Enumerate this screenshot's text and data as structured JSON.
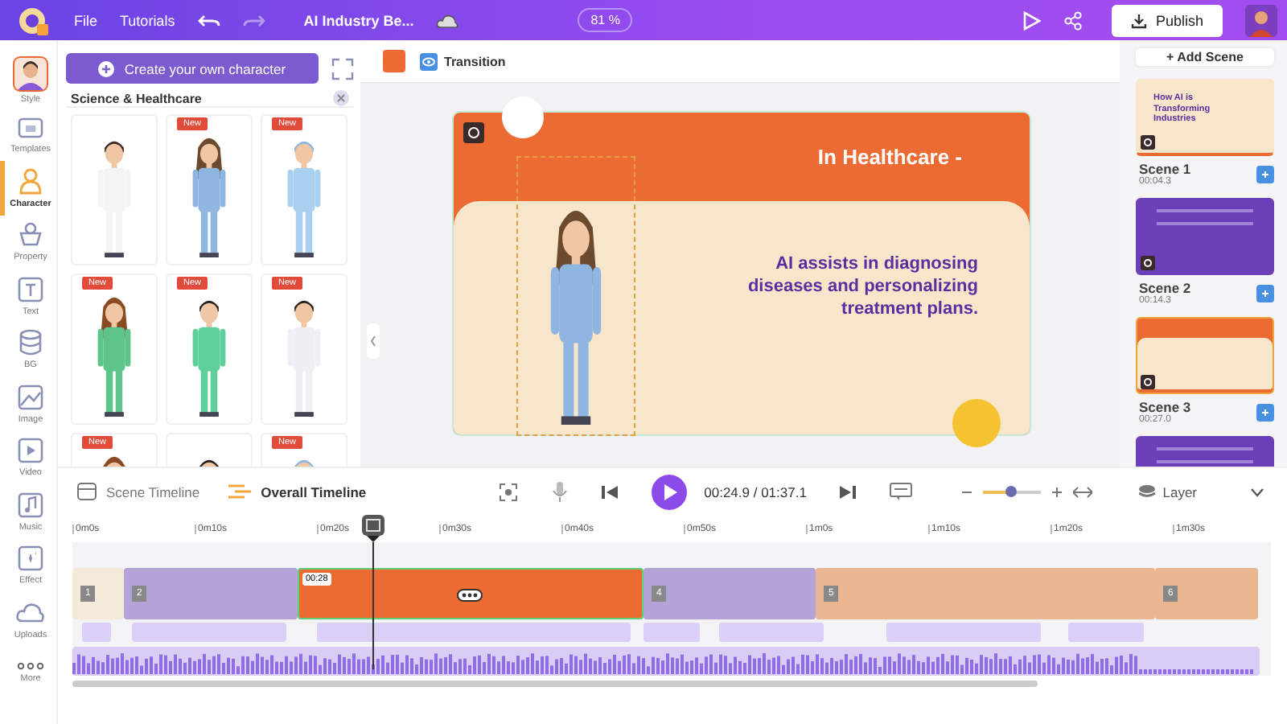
{
  "top_bar": {
    "menu": [
      "File",
      "Tutorials"
    ],
    "title": "AI Industry Be...",
    "zoom": "81 %",
    "publish": "Publish"
  },
  "rail": [
    {
      "label": "Style",
      "kind": "avatar",
      "selected": false
    },
    {
      "label": "Templates",
      "kind": "templates",
      "selected": false
    },
    {
      "label": "Character",
      "kind": "character",
      "selected": true
    },
    {
      "label": "Property",
      "kind": "property",
      "selected": false
    },
    {
      "label": "Text",
      "kind": "text",
      "selected": false
    },
    {
      "label": "BG",
      "kind": "bg",
      "selected": false
    },
    {
      "label": "Image",
      "kind": "image",
      "selected": false
    },
    {
      "label": "Video",
      "kind": "video",
      "selected": false
    },
    {
      "label": "Music",
      "kind": "music",
      "selected": false
    },
    {
      "label": "Effect",
      "kind": "effect",
      "selected": false
    },
    {
      "label": "Uploads",
      "kind": "uploads",
      "selected": false
    },
    {
      "label": "More",
      "kind": "more",
      "selected": false
    }
  ],
  "panel": {
    "create_button": "Create your own character",
    "category": "Science & Healthcare",
    "characters": [
      {
        "kind": "doctor"
      },
      {
        "kind": "woman",
        "badge": "New"
      },
      {
        "kind": "nurse",
        "badge": "New"
      },
      {
        "kind": "curly",
        "badge": "New"
      },
      {
        "kind": "scrubs",
        "badge": "New"
      },
      {
        "kind": "suit",
        "badge": "New"
      },
      {
        "kind": "curly",
        "badge": "New"
      },
      {
        "kind": "coat"
      },
      {
        "kind": "nurse",
        "badge": "New"
      }
    ]
  },
  "canvas": {
    "transition": "Transition",
    "slide": {
      "heading": "In Healthcare -",
      "body": "AI assists in diagnosing diseases and personalizing treatment plans."
    }
  },
  "scenes_panel": {
    "add_scene": "+ Add Scene",
    "scenes": [
      {
        "kind": "title",
        "thumb_text": "How AI is Transforming Industries",
        "title": "Scene 1",
        "duration": "00:04.3",
        "selected": false
      },
      {
        "kind": "purple",
        "title": "Scene 2",
        "duration": "00:14.3",
        "selected": false
      },
      {
        "kind": "healthcare",
        "title": "Scene 3",
        "duration": "00:27.0",
        "selected": true
      },
      {
        "kind": "purple",
        "selected": false
      }
    ]
  },
  "timeline": {
    "tabs": [
      {
        "label": "Scene Timeline",
        "selected": false
      },
      {
        "label": "Overall Timeline",
        "selected": true
      }
    ],
    "time": "00:24.9 / 01:37.1",
    "zoom_slider": {
      "level": 0.5
    },
    "layer": "Layer",
    "ruler": [
      "0m0s",
      "0m10s",
      "0m20s",
      "0m30s",
      "0m40s",
      "0m50s",
      "1m0s",
      "1m10s",
      "1m20s",
      "1m30s"
    ],
    "clips": [
      {
        "number": "1",
        "color": "#f4ead9",
        "selected": false
      },
      {
        "number": "2",
        "color": "#b3a3d6",
        "selected": false
      },
      {
        "tag": "00:28",
        "color": "#ec6b33",
        "selected": true
      },
      {
        "number": "4",
        "color": "#b3a3d6",
        "selected": false
      },
      {
        "number": "5",
        "color": "#ebb692",
        "selected": false
      },
      {
        "number": "6",
        "color": "#ebb692",
        "selected": false
      }
    ]
  }
}
